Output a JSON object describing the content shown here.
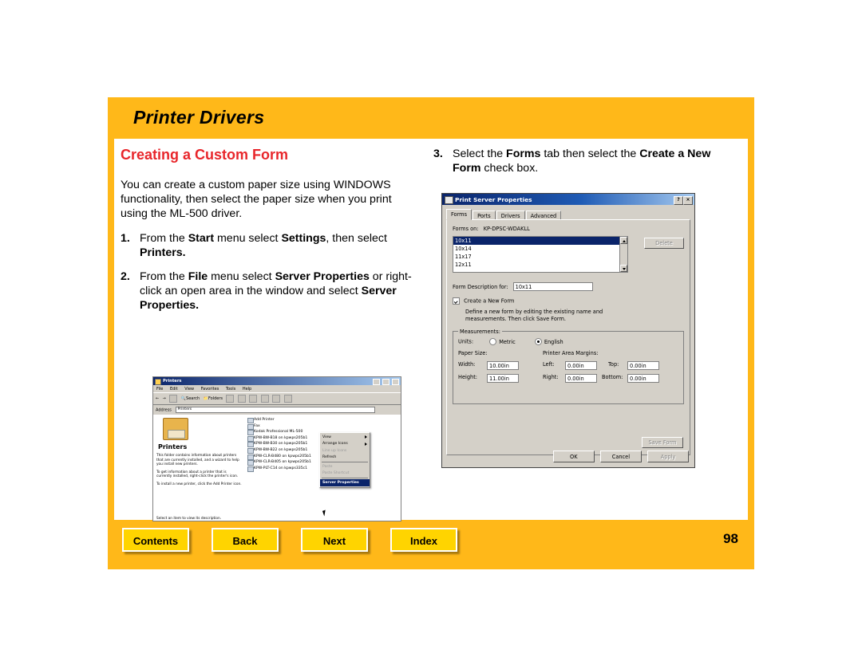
{
  "page": {
    "header_title": "Printer Drivers",
    "section_title": "Creating a Custom Form",
    "page_number": "98",
    "intro_paragraph": "You can create a custom paper size using WINDOWS functionality, then select the paper size when you print using the ML-500 driver."
  },
  "steps": [
    {
      "num": "1.",
      "parts": [
        {
          "t": "From the ",
          "b": false
        },
        {
          "t": "Start",
          "b": true
        },
        {
          "t": " menu select ",
          "b": false
        },
        {
          "t": "Settings",
          "b": true
        },
        {
          "t": ", then select ",
          "b": false
        },
        {
          "t": "Printers.",
          "b": true
        }
      ]
    },
    {
      "num": "2.",
      "parts": [
        {
          "t": "From the ",
          "b": false
        },
        {
          "t": "File",
          "b": true
        },
        {
          "t": " menu select ",
          "b": false
        },
        {
          "t": "Server Properties",
          "b": true
        },
        {
          "t": " or right-click an open area in the window and select ",
          "b": false
        },
        {
          "t": "Server Properties.",
          "b": true
        }
      ]
    },
    {
      "num": "3.",
      "parts": [
        {
          "t": "Select the ",
          "b": false
        },
        {
          "t": "Forms",
          "b": true
        },
        {
          "t": " tab then select the ",
          "b": false
        },
        {
          "t": "Create a New Form",
          "b": true
        },
        {
          "t": " check box.",
          "b": false
        }
      ]
    }
  ],
  "nav": {
    "contents": "Contents",
    "back": "Back",
    "next": "Next",
    "index": "Index"
  },
  "printers_window": {
    "title": "Printers",
    "menus": [
      "File",
      "Edit",
      "View",
      "Favorites",
      "Tools",
      "Help"
    ],
    "toolbar": [
      "Back",
      "Forward",
      "Up",
      "Search",
      "Folders",
      "History"
    ],
    "address_label": "Address",
    "address_value": "Printers",
    "folder_label": "Printers",
    "description_1": "This folder contains information about printers that are currently installed, and a wizard to help you install new printers.",
    "description_2": "To get information about a printer that is currently installed, right-click the printer's icon.",
    "description_3": "To install a new printer, click the Add Printer icon.",
    "status_bar": "Select an item to view its description.",
    "list_items": [
      "Add Printer",
      "Fax",
      "Kodak Professional ML-500",
      "KPW-BW-B18 on kpwps205b1",
      "KPW-BW-B30 on kpwps205b1",
      "KPW-BW-B22 on kpwps205b1",
      "KPW-CLR-B480 on kpwps205b1",
      "KPW-CLR-B405 on kpwps205b1",
      "KPW-PLT-C14 on kpwps335c1"
    ],
    "context_menu": [
      {
        "label": "View",
        "state": "submenu"
      },
      {
        "label": "Arrange Icons",
        "state": "submenu"
      },
      {
        "label": "Line up Icons",
        "state": "disabled"
      },
      {
        "label": "Refresh",
        "state": "normal"
      },
      {
        "label": "Paste",
        "state": "disabled"
      },
      {
        "label": "Paste Shortcut",
        "state": "disabled"
      },
      {
        "label": "Server Properties",
        "state": "selected"
      }
    ]
  },
  "psp_dialog": {
    "title": "Print Server Properties",
    "help_button": "?",
    "close_button": "×",
    "tabs": [
      "Forms",
      "Ports",
      "Drivers",
      "Advanced"
    ],
    "active_tab": "Forms",
    "forms_on_label": "Forms on:",
    "forms_on_value": "KP-DPSC-WDAKLL",
    "forms_list": [
      "10x11",
      "10x14",
      "11x17",
      "12x11"
    ],
    "forms_selected": "10x11",
    "delete_button": "Delete",
    "form_description_label": "Form Description for:",
    "form_description_value": "10x11",
    "create_new_form_label": "Create a New Form",
    "create_new_form_checked": true,
    "create_help_text": "Define a new form by editing the existing name and measurements. Then click Save Form.",
    "measurements_label": "Measurements:",
    "units_label": "Units:",
    "units_metric": "Metric",
    "units_english": "English",
    "units_selected": "English",
    "paper_size_label": "Paper Size:",
    "width_label": "Width:",
    "width_value": "10.00in",
    "height_label": "Height:",
    "height_value": "11.00in",
    "margins_label": "Printer Area Margins:",
    "left_label": "Left:",
    "left_value": "0.00in",
    "right_label": "Right:",
    "right_value": "0.00in",
    "top_label": "Top:",
    "top_value": "0.00in",
    "bottom_label": "Bottom:",
    "bottom_value": "0.00in",
    "save_form_button": "Save Form",
    "ok_button": "OK",
    "cancel_button": "Cancel",
    "apply_button": "Apply"
  },
  "colors": {
    "page_bg": "#ffb819",
    "section_title": "#e8262b",
    "button_bg": "#ffd400"
  }
}
